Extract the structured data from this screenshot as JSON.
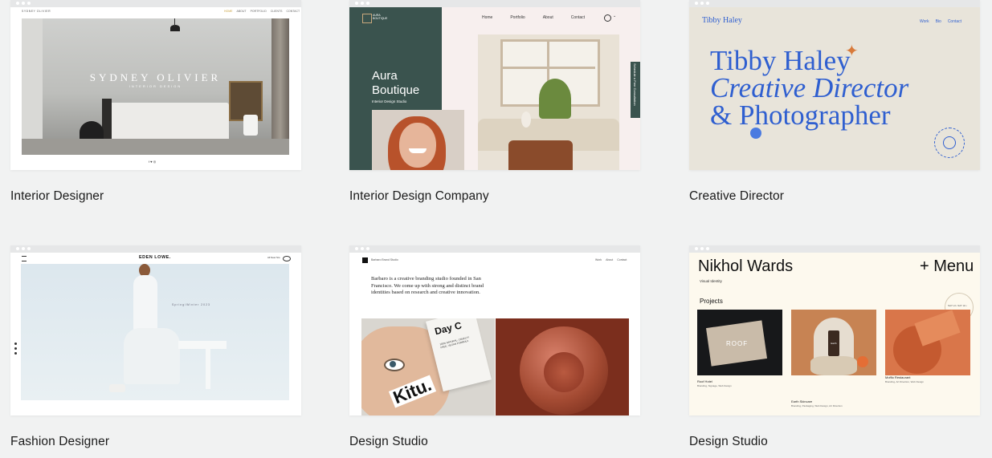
{
  "templates": [
    {
      "caption": "Interior Designer",
      "preview": {
        "logo": "SYDNEY OLIVIER",
        "nav": [
          "HOME",
          "ABOUT",
          "PORTFOLIO",
          "CLIENTS",
          "CONTACT"
        ],
        "title": "SYDNEY OLIVIER",
        "subtitle": "INTERIOR DESIGN",
        "socials": "f ♥ ◎"
      }
    },
    {
      "caption": "Interior Design Company",
      "preview": {
        "logo_line1": "AURA",
        "logo_line2": "BOUTIQUE",
        "nav": [
          "Home",
          "Portfolio",
          "About",
          "Contact"
        ],
        "title_line1": "Aura",
        "title_line2": "Boutique",
        "subtitle": "Interior Design Studio",
        "side_tab": "Schedule a Free Consultation"
      }
    },
    {
      "caption": "Creative Director",
      "preview": {
        "logo": "Tibby Haley",
        "nav": [
          "Work",
          "Bio",
          "Contact"
        ],
        "line1": "Tibby Haley",
        "line2": "Creative Director",
        "line3": "& Photographer"
      }
    },
    {
      "caption": "Fashion Designer",
      "preview": {
        "logo": "EDEN LOWE.",
        "right_label": "All New Sto",
        "overlay": "Spring/Winter 2023"
      }
    },
    {
      "caption": "Design Studio",
      "preview": {
        "logo": "Barbaro Brand Studio",
        "nav": [
          "Work",
          "About",
          "Contact"
        ],
        "intro": "Barbaro is a creative branding studio founded in San Francisco. We come up with strong and distinct brand identities based on research and creative innovation.",
        "box_word": "Kitu.",
        "box_small": "Day C",
        "box_text": "100% NATURAL, CRUELTY FREE, VEGAN FORMULA"
      }
    },
    {
      "caption": "Design Studio",
      "preview": {
        "title": "Nikhol Wards",
        "menu": "+ Menu",
        "subtitle": "Visual Identity",
        "section": "Projects",
        "badge": "SAY HI • SAY HI •",
        "projects": [
          {
            "name": "Roof Hotel",
            "tags": "Branding, Signage, Web Design",
            "mark": "ROOF"
          },
          {
            "name": "Earth Skincare",
            "tags": "Branding, Packaging, Web Design, Art Direction",
            "label": "Earth"
          },
          {
            "name": "Moffio Restaurant",
            "tags": "Branding, Art Direction, Web Design"
          }
        ]
      }
    }
  ],
  "colors": {
    "page_bg": "#f1f2f2",
    "aura_green": "#3a534e",
    "tibby_blue": "#2f5fd0",
    "tibby_bg": "#e8e4da",
    "nikhol_bg": "#fdf9ee"
  },
  "icons": [
    "hamburger-icon",
    "eye-icon",
    "globe-icon",
    "user-icon",
    "sparkle-icon"
  ]
}
